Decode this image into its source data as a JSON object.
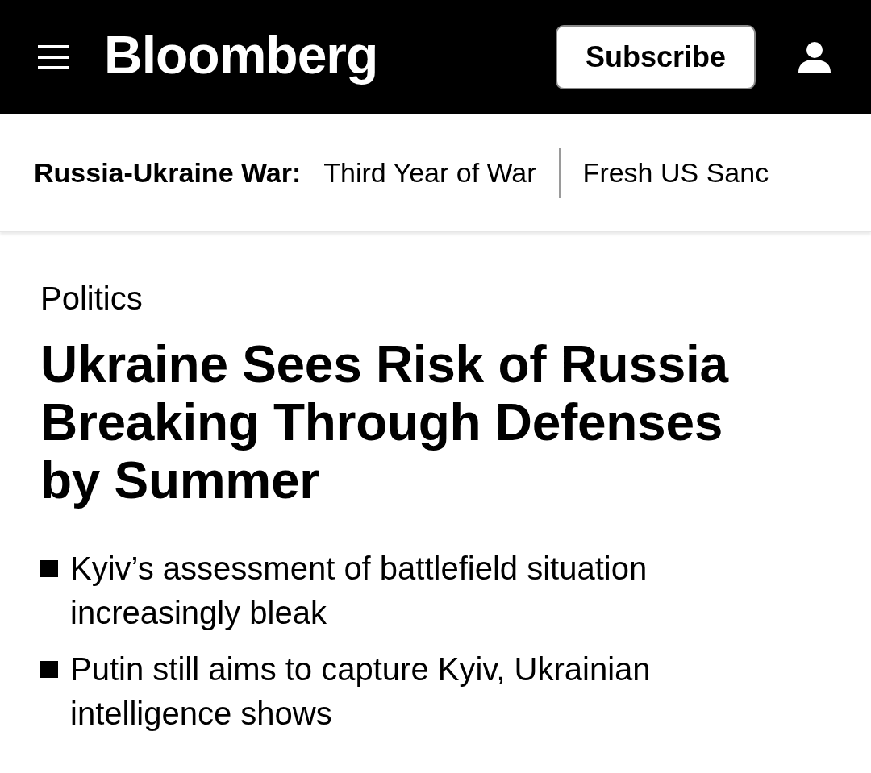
{
  "header": {
    "logo": "Bloomberg",
    "subscribe_button": "Subscribe"
  },
  "topic_bar": {
    "label": "Russia-Ukraine War:",
    "links": [
      "Third Year of War",
      "Fresh US Sanc"
    ]
  },
  "article": {
    "section": "Politics",
    "headline": "Ukraine Sees Risk of Russia Breaking Through Defenses by Summer",
    "bullets": [
      "Kyiv’s assessment of battlefield situation increasingly bleak",
      "Putin still aims to capture Kyiv, Ukrainian intelligence shows"
    ]
  }
}
